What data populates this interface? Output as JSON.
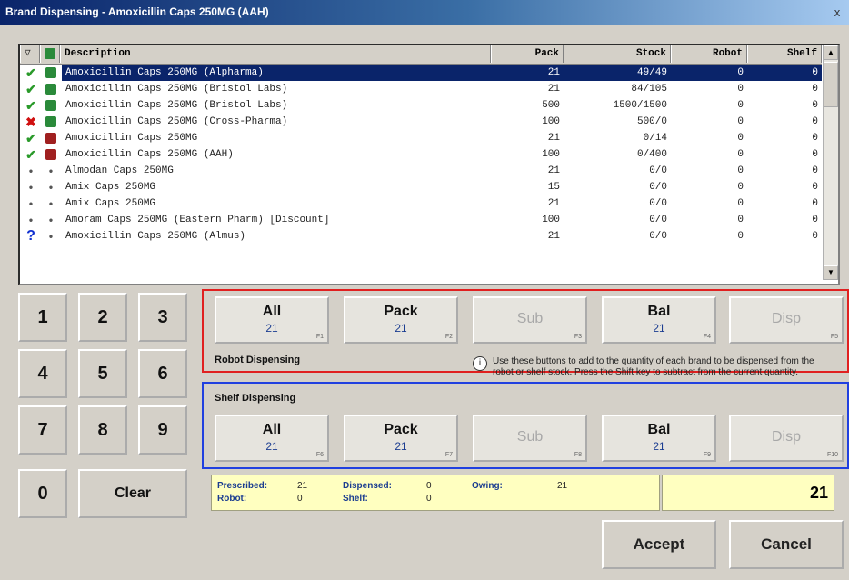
{
  "window": {
    "title": "Brand Dispensing - Amoxicillin Caps 250MG (AAH)",
    "close": "x"
  },
  "grid": {
    "headers": {
      "c1": "▽",
      "c2": "",
      "description": "Description",
      "pack": "Pack",
      "stock": "Stock",
      "robot": "Robot",
      "shelf": "Shelf"
    },
    "rows": [
      {
        "s1": "tick",
        "s2": "pkg-g",
        "description": "Amoxicillin Caps 250MG (Alpharma)",
        "pack": "21",
        "stock": "49/49",
        "robot": "0",
        "shelf": "0",
        "selected": true
      },
      {
        "s1": "tick",
        "s2": "pkg-g",
        "description": "Amoxicillin Caps 250MG (Bristol Labs)",
        "pack": "21",
        "stock": "84/105",
        "robot": "0",
        "shelf": "0"
      },
      {
        "s1": "tick",
        "s2": "pkg-g",
        "description": "Amoxicillin Caps 250MG (Bristol Labs)",
        "pack": "500",
        "stock": "1500/1500",
        "robot": "0",
        "shelf": "0"
      },
      {
        "s1": "cross",
        "s2": "pkg-g",
        "description": "Amoxicillin Caps 250MG (Cross-Pharma)",
        "pack": "100",
        "stock": "500/0",
        "robot": "0",
        "shelf": "0"
      },
      {
        "s1": "tick",
        "s2": "pkg-r",
        "description": "Amoxicillin Caps 250MG",
        "pack": "21",
        "stock": "0/14",
        "robot": "0",
        "shelf": "0"
      },
      {
        "s1": "tick",
        "s2": "pkg-r",
        "description": "Amoxicillin Caps 250MG (AAH)",
        "pack": "100",
        "stock": "0/400",
        "robot": "0",
        "shelf": "0"
      },
      {
        "s1": "dot",
        "s2": "dot",
        "description": "Almodan Caps 250MG",
        "pack": "21",
        "stock": "0/0",
        "robot": "0",
        "shelf": "0"
      },
      {
        "s1": "dot",
        "s2": "dot",
        "description": "Amix Caps 250MG",
        "pack": "15",
        "stock": "0/0",
        "robot": "0",
        "shelf": "0"
      },
      {
        "s1": "dot",
        "s2": "dot",
        "description": "Amix Caps 250MG",
        "pack": "21",
        "stock": "0/0",
        "robot": "0",
        "shelf": "0"
      },
      {
        "s1": "dot",
        "s2": "dot",
        "description": "Amoram Caps 250MG (Eastern Pharm) [Discount]",
        "pack": "100",
        "stock": "0/0",
        "robot": "0",
        "shelf": "0"
      },
      {
        "s1": "q",
        "s2": "dot",
        "description": "Amoxicillin Caps 250MG (Almus)",
        "pack": "21",
        "stock": "0/0",
        "robot": "0",
        "shelf": "0"
      }
    ]
  },
  "keypad": {
    "k1": "1",
    "k2": "2",
    "k3": "3",
    "k4": "4",
    "k5": "5",
    "k6": "6",
    "k7": "7",
    "k8": "8",
    "k9": "9",
    "k0": "0",
    "clear": "Clear"
  },
  "robot": {
    "label": "Robot Dispensing",
    "all": {
      "label": "All",
      "value": "21",
      "fkey": "F1"
    },
    "pack": {
      "label": "Pack",
      "value": "21",
      "fkey": "F2"
    },
    "sub": {
      "label": "Sub",
      "fkey": "F3"
    },
    "bal": {
      "label": "Bal",
      "value": "21",
      "fkey": "F4"
    },
    "disp": {
      "label": "Disp",
      "fkey": "F5"
    }
  },
  "shelf": {
    "label": "Shelf Dispensing",
    "all": {
      "label": "All",
      "value": "21",
      "fkey": "F6"
    },
    "pack": {
      "label": "Pack",
      "value": "21",
      "fkey": "F7"
    },
    "sub": {
      "label": "Sub",
      "fkey": "F8"
    },
    "bal": {
      "label": "Bal",
      "value": "21",
      "fkey": "F9"
    },
    "disp": {
      "label": "Disp",
      "fkey": "F10"
    }
  },
  "info_text": "Use these buttons to add to the quantity of each brand to be dispensed from the robot or shelf stock. Press the Shift key to subtract from the current quantity.",
  "summary": {
    "prescribed_label": "Prescribed:",
    "prescribed": "21",
    "dispensed_label": "Dispensed:",
    "dispensed": "0",
    "owing_label": "Owing:",
    "owing": "21",
    "robot_label": "Robot:",
    "robot": "0",
    "shelf_label": "Shelf:",
    "shelf": "0",
    "total": "21"
  },
  "actions": {
    "accept": "Accept",
    "cancel": "Cancel"
  },
  "colors": {
    "title_bar": "#0a246a",
    "selected_row": "#0a246a",
    "robot_frame": "#e02020",
    "shelf_frame": "#2040e0",
    "summary_bg": "#ffffc0"
  }
}
